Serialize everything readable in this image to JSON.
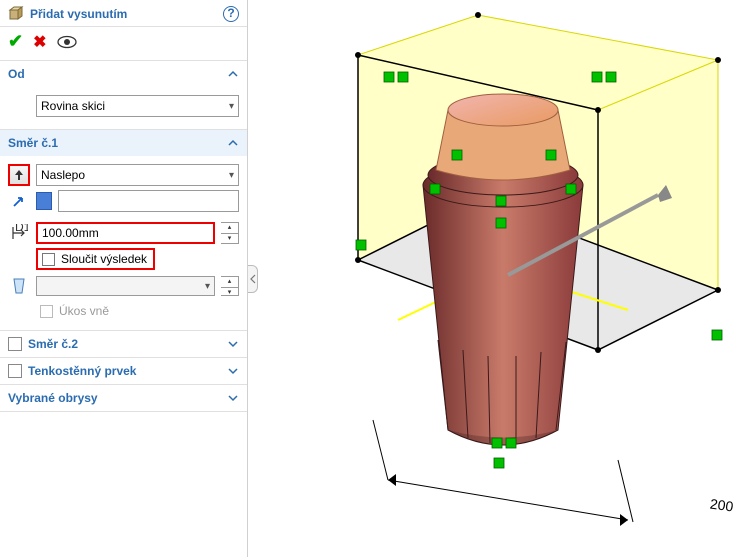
{
  "header": {
    "title": "Přidat vysunutím"
  },
  "sections": {
    "od": {
      "title": "Od",
      "dropdown": "Rovina skici"
    },
    "smer1": {
      "title": "Směr č.1",
      "end_cond": "Naslepo",
      "selection": "",
      "depth": "100.00mm",
      "merge_label": "Sloučit výsledek",
      "draft_selection": "",
      "draft_out_label": "Úkos vně"
    },
    "smer2": {
      "title": "Směr č.2"
    },
    "thin": {
      "title": "Tenkostěnný prvek"
    },
    "contours": {
      "title": "Vybrané obrysy"
    }
  },
  "viewport": {
    "dimension": "200"
  }
}
